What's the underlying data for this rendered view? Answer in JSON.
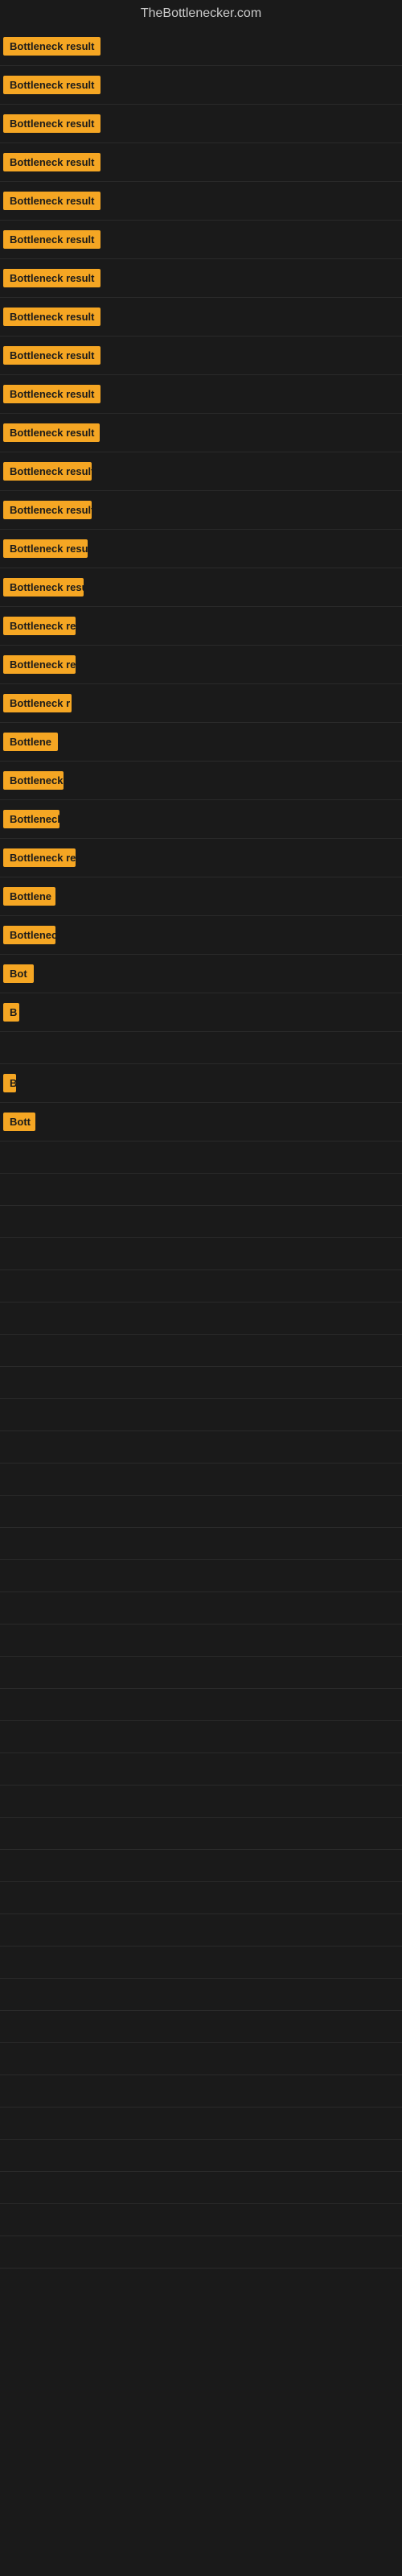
{
  "site": {
    "title": "TheBottlenecker.com"
  },
  "rows": [
    {
      "id": 1,
      "label": "Bottleneck result",
      "size_class": "item-1"
    },
    {
      "id": 2,
      "label": "Bottleneck result",
      "size_class": "item-2"
    },
    {
      "id": 3,
      "label": "Bottleneck result",
      "size_class": "item-3"
    },
    {
      "id": 4,
      "label": "Bottleneck result",
      "size_class": "item-4"
    },
    {
      "id": 5,
      "label": "Bottleneck result",
      "size_class": "item-5"
    },
    {
      "id": 6,
      "label": "Bottleneck result",
      "size_class": "item-6"
    },
    {
      "id": 7,
      "label": "Bottleneck result",
      "size_class": "item-7"
    },
    {
      "id": 8,
      "label": "Bottleneck result",
      "size_class": "item-8"
    },
    {
      "id": 9,
      "label": "Bottleneck result",
      "size_class": "item-9"
    },
    {
      "id": 10,
      "label": "Bottleneck result",
      "size_class": "item-10"
    },
    {
      "id": 11,
      "label": "Bottleneck result",
      "size_class": "item-11"
    },
    {
      "id": 12,
      "label": "Bottleneck result",
      "size_class": "item-12"
    },
    {
      "id": 13,
      "label": "Bottleneck result",
      "size_class": "item-13"
    },
    {
      "id": 14,
      "label": "Bottleneck result",
      "size_class": "item-14"
    },
    {
      "id": 15,
      "label": "Bottleneck result",
      "size_class": "item-15"
    },
    {
      "id": 16,
      "label": "Bottleneck re",
      "size_class": "item-16"
    },
    {
      "id": 17,
      "label": "Bottleneck result",
      "size_class": "item-17"
    },
    {
      "id": 18,
      "label": "Bottleneck r",
      "size_class": "item-18"
    },
    {
      "id": 19,
      "label": "Bottlene",
      "size_class": "item-19"
    },
    {
      "id": 20,
      "label": "Bottleneck r",
      "size_class": "item-20"
    },
    {
      "id": 21,
      "label": "Bottleneck",
      "size_class": "item-21"
    },
    {
      "id": 22,
      "label": "Bottleneck res",
      "size_class": "item-22"
    },
    {
      "id": 23,
      "label": "Bottlene",
      "size_class": "item-23"
    },
    {
      "id": 24,
      "label": "Bottleneck",
      "size_class": "item-24"
    },
    {
      "id": 25,
      "label": "Bot",
      "size_class": "item-25"
    },
    {
      "id": 26,
      "label": "B",
      "size_class": "item-26"
    },
    {
      "id": 27,
      "label": "",
      "size_class": "item-27"
    },
    {
      "id": 28,
      "label": "B",
      "size_class": "item-28"
    },
    {
      "id": 29,
      "label": "Bott",
      "size_class": "item-29"
    },
    {
      "id": 30,
      "label": "",
      "size_class": "item-30"
    },
    {
      "id": 31,
      "label": "",
      "size_class": "item-31"
    },
    {
      "id": 32,
      "label": "",
      "size_class": "item-32"
    },
    {
      "id": 33,
      "label": "",
      "size_class": "item-33"
    },
    {
      "id": 34,
      "label": "",
      "size_class": "item-34"
    }
  ]
}
